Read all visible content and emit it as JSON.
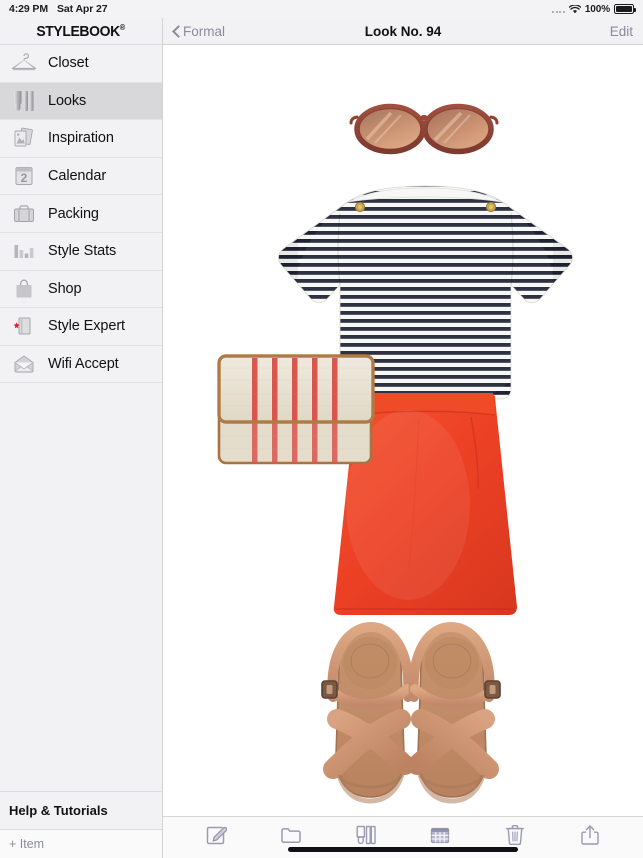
{
  "status_bar": {
    "time": "4:29 PM",
    "date": "Sat Apr 27",
    "battery_percent": "100%",
    "signal_icon": "signal-dots-icon",
    "wifi_icon": "wifi-icon",
    "battery_icon": "battery-full-icon"
  },
  "sidebar": {
    "brand": "STYLEBOOK",
    "brand_mark": "®",
    "items": [
      {
        "label": "Closet",
        "icon": "hanger-icon",
        "selected": false
      },
      {
        "label": "Looks",
        "icon": "outfit-icon",
        "selected": true
      },
      {
        "label": "Inspiration",
        "icon": "photos-icon",
        "selected": false
      },
      {
        "label": "Calendar",
        "icon": "calendar-icon",
        "selected": false
      },
      {
        "label": "Packing",
        "icon": "suitcase-icon",
        "selected": false
      },
      {
        "label": "Style Stats",
        "icon": "bar-chart-icon",
        "selected": false
      },
      {
        "label": "Shop",
        "icon": "shopping-bag-icon",
        "selected": false
      },
      {
        "label": "Style Expert",
        "icon": "book-star-icon",
        "selected": false
      },
      {
        "label": "Wifi Accept",
        "icon": "envelope-icon",
        "selected": false
      }
    ],
    "help_label": "Help & Tutorials",
    "add_item_label": "+ Item"
  },
  "navbar": {
    "back_label": "Formal",
    "back_icon": "chevron-left-icon",
    "title": "Look No. 94",
    "edit_label": "Edit"
  },
  "toolbar": {
    "buttons": [
      {
        "name": "edit-look-button",
        "icon": "compose-icon"
      },
      {
        "name": "folder-button",
        "icon": "folder-icon"
      },
      {
        "name": "outfit-view-button",
        "icon": "outfit-icon"
      },
      {
        "name": "calendar-button",
        "icon": "calendar-grid-icon"
      },
      {
        "name": "delete-button",
        "icon": "trash-icon"
      },
      {
        "name": "share-button",
        "icon": "share-icon"
      }
    ]
  },
  "look": {
    "items": [
      {
        "name": "sunglasses",
        "description": "Brown rounded cat-eye sunglasses",
        "color": "#9a4f40"
      },
      {
        "name": "striped-top",
        "description": "Navy and white striped boat-neck top with gold shoulder buttons",
        "color": "#1f2233"
      },
      {
        "name": "clutch",
        "description": "Linen clutch with red vertical stripes and tan leather trim",
        "color": "#e2dccd"
      },
      {
        "name": "skirt",
        "description": "Red-orange A-line mini skirt",
        "color": "#ee4426"
      },
      {
        "name": "sandals",
        "description": "Tan leather crossover platform sandals",
        "color": "#c99274"
      }
    ]
  },
  "colors": {
    "accent": "#8b8b9c",
    "sidebar_bg": "#f2f2f4",
    "selected_row": "#d8d8da",
    "skirt_red": "#ee4426",
    "stripe_navy": "#1f2233",
    "sandal_tan": "#c99274"
  }
}
